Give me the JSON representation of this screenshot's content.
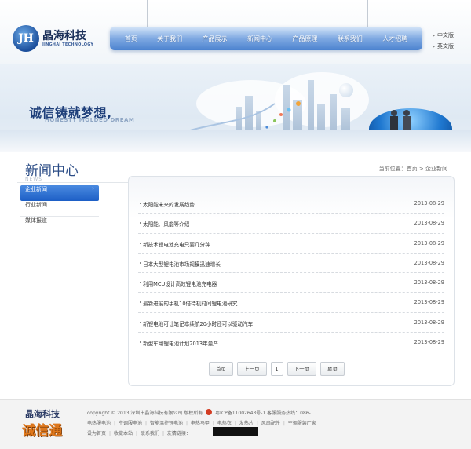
{
  "header": {
    "logo_mark": "JH",
    "logo_cn": "晶海科技",
    "logo_en": "JINGHAI TECHNOLOGY",
    "nav": [
      "首页",
      "关于我们",
      "产品展示",
      "新闻中心",
      "产品原理",
      "联系我们",
      "人才招聘"
    ],
    "lang": [
      "中文版",
      "英文版"
    ]
  },
  "banner": {
    "slogan": "诚信铸就梦想,",
    "slogan_en": "HONESTY MOLDED DREAM"
  },
  "section": {
    "title": "新闻中心",
    "title_en": "NEWS",
    "breadcrumb_prefix": "当前位置：",
    "breadcrumb_home": "首页",
    "breadcrumb_sep": " > ",
    "breadcrumb_current": "企业新闻"
  },
  "sidebar": {
    "items": [
      {
        "label": "企业新闻",
        "active": true,
        "arrow": "›"
      },
      {
        "label": "行业新闻"
      },
      {
        "label": "媒体报道"
      }
    ]
  },
  "news": {
    "items": [
      {
        "title": "太阳能未来的发展趋势",
        "date": "2013-08-29"
      },
      {
        "title": "太阳能、风能等介绍",
        "date": "2013-08-29"
      },
      {
        "title": "新技术锂电池充电只要几分钟",
        "date": "2013-08-29"
      },
      {
        "title": "日本大型锂电池市场规模迅速增长",
        "date": "2013-08-29"
      },
      {
        "title": "利用MCU设计高效锂电池充电器",
        "date": "2013-08-29"
      },
      {
        "title": "最新进展的手机10倍待机时间锂电池研究",
        "date": "2013-08-29"
      },
      {
        "title": "新锂电池可让笔记本续航20小时还可以驱动汽车",
        "date": "2013-08-29"
      },
      {
        "title": "新型车用锂电池计划2013年量产",
        "date": "2013-08-29"
      }
    ],
    "pager": {
      "first": "首页",
      "prev": "上一页",
      "current": "1",
      "next": "下一页",
      "last": "尾页"
    }
  },
  "footer": {
    "logo_cn": "晶海科技",
    "logo_badge": "诚信通",
    "copyright": "copyright © 2013 深圳市晶海科技有限公司 版权所有",
    "icp": "粤ICP备11002643号-1 客服服务热线：086-",
    "links_row1": [
      "电热服电池",
      "空调服电池",
      "智能温控锂电池",
      "电热马甲",
      "电热衣",
      "发热片",
      "风扇配件",
      "空调服装厂家"
    ],
    "links_row2": [
      "设为首页",
      "收藏本站",
      "联系我们"
    ],
    "friend_links_label": "友情链接："
  }
}
